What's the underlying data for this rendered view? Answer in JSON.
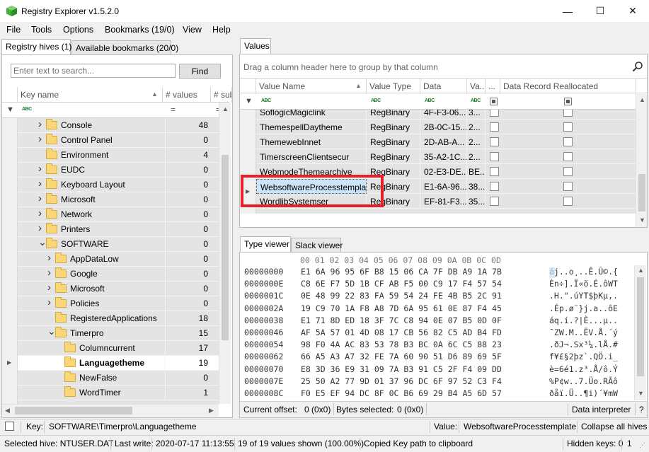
{
  "window": {
    "title": "Registry Explorer v1.5.2.0",
    "minimize": "—",
    "maximize": "☐",
    "close": "✕"
  },
  "menu": [
    "File",
    "Tools",
    "Options",
    "Bookmarks (19/0)",
    "View",
    "Help"
  ],
  "left_tabs": [
    "Registry hives (1)",
    "Available bookmarks (20/0)"
  ],
  "search": {
    "placeholder": "Enter text to search...",
    "button": "Find"
  },
  "tree_headers": {
    "key_name": "Key name",
    "values": "# values",
    "subkeys": "# sub"
  },
  "tree_rows": [
    {
      "name": "Console",
      "values": "48",
      "level": 0,
      "chevron": "right"
    },
    {
      "name": "Control Panel",
      "values": "0",
      "level": 0,
      "chevron": "right"
    },
    {
      "name": "Environment",
      "values": "4",
      "level": 0,
      "chevron": "none"
    },
    {
      "name": "EUDC",
      "values": "0",
      "level": 0,
      "chevron": "right"
    },
    {
      "name": "Keyboard Layout",
      "values": "0",
      "level": 0,
      "chevron": "right"
    },
    {
      "name": "Microsoft",
      "values": "0",
      "level": 0,
      "chevron": "right"
    },
    {
      "name": "Network",
      "values": "0",
      "level": 0,
      "chevron": "right"
    },
    {
      "name": "Printers",
      "values": "0",
      "level": 0,
      "chevron": "right"
    },
    {
      "name": "SOFTWARE",
      "values": "0",
      "level": 0,
      "chevron": "down"
    },
    {
      "name": "AppDataLow",
      "values": "0",
      "level": 1,
      "chevron": "right"
    },
    {
      "name": "Google",
      "values": "0",
      "level": 1,
      "chevron": "right"
    },
    {
      "name": "Microsoft",
      "values": "0",
      "level": 1,
      "chevron": "right"
    },
    {
      "name": "Policies",
      "values": "0",
      "level": 1,
      "chevron": "right"
    },
    {
      "name": "RegisteredApplications",
      "values": "18",
      "level": 1,
      "chevron": "none"
    },
    {
      "name": "Timerpro",
      "values": "15",
      "level": 1,
      "chevron": "down"
    },
    {
      "name": "Columncurrent",
      "values": "17",
      "level": 2,
      "chevron": "none"
    },
    {
      "name": "Languagetheme",
      "values": "19",
      "level": 2,
      "chevron": "none",
      "selected": true
    },
    {
      "name": "NewFalse",
      "values": "0",
      "level": 2,
      "chevron": "none"
    },
    {
      "name": "WordTimer",
      "values": "1",
      "level": 2,
      "chevron": "none"
    }
  ],
  "values_tab": "Values",
  "group_hint": "Drag a column header here to group by that column",
  "value_headers": {
    "name": "Value Name",
    "type": "Value Type",
    "data": "Data",
    "va": "Va...",
    "dots": "...",
    "reallocated": "Data Record Reallocated"
  },
  "value_rows": [
    {
      "name": "SoflogicMagiclink",
      "type": "RegBinary",
      "data": "4F-F3-06...",
      "va": "3..."
    },
    {
      "name": "ThemespellDaytheme",
      "type": "RegBinary",
      "data": "2B-0C-15...",
      "va": "2..."
    },
    {
      "name": "ThemewebInnet",
      "type": "RegBinary",
      "data": "2D-AB-A...",
      "va": "2..."
    },
    {
      "name": "TimerscreenClientsecur",
      "type": "RegBinary",
      "data": "35-A2-1C...",
      "va": "2..."
    },
    {
      "name": "WebmodeThemearchive",
      "type": "RegBinary",
      "data": "02-E3-DE...",
      "va": "BE..."
    },
    {
      "name": "WebsoftwareProcesstemplate",
      "type": "RegBinary",
      "data": "E1-6A-96...",
      "va": "38...",
      "selected": true
    },
    {
      "name": "WordlibSystemser",
      "type": "RegBinary",
      "data": "EF-81-F3...",
      "va": "35..."
    }
  ],
  "bottom_tabs": [
    "Type viewer",
    "Slack viewer"
  ],
  "hex_header": "00 01 02 03 04 05 06 07 08 09 0A 0B 0C 0D",
  "hex_rows": [
    {
      "off": "00000000",
      "bytes": "E1 6A 96 95 6F B8 15 06 CA 7F DB A9 1A 7B",
      "ascii": "áj..o¸..Ê.Û©.{"
    },
    {
      "off": "0000000E",
      "bytes": "C8 6E F7 5D 1B CF AB F5 00 C9 17 F4 57 54",
      "ascii": "Èn÷].Ï«õ.É.ôWT"
    },
    {
      "off": "0000001C",
      "bytes": "0E 48 99 22 83 FA 59 54 24 FE 4B B5 2C 91",
      "ascii": ".H.\".úYT$þKµ,."
    },
    {
      "off": "0000002A",
      "bytes": "19 C9 70 1A F8 A8 7D 6A 95 61 0E 87 F4 45",
      "ascii": ".Ép.ø¨}j.a..ôE"
    },
    {
      "off": "00000038",
      "bytes": "E1 71 8D ED 18 3F 7C C8 94 0E 07 B5 0D 0F",
      "ascii": "áq.í.?|È...µ.."
    },
    {
      "off": "00000046",
      "bytes": "AF 5A 57 01 4D 08 17 CB 56 82 C5 AD B4 FD",
      "ascii": "¯ZW.M..ËV.Å.´ý"
    },
    {
      "off": "00000054",
      "bytes": "98 F0 4A AC 83 53 78 B3 BC 0A 6C C5 88 23",
      "ascii": ".ðJ¬.Sx³¼.lÅ.#"
    },
    {
      "off": "00000062",
      "bytes": "66 A5 A3 A7 32 FE 7A 60 90 51 D6 89 69 5F",
      "ascii": "f¥£§2þz`.QÖ.i_"
    },
    {
      "off": "00000070",
      "bytes": "E8 3D 36 E9 31 09 7A B3 91 C5 2F F4 09 DD",
      "ascii": "è=6é1.z³.Å/ô.Ý"
    },
    {
      "off": "0000007E",
      "bytes": "25 50 A2 77 9D 01 37 96 DC 6F 97 52 C3 F4",
      "ascii": "%P¢w..7.Üo.RÃô"
    },
    {
      "off": "0000008C",
      "bytes": "F0 E5 EF 94 DC 8F 0C B6 69 29 B4 A5 6D 57",
      "ascii": "ðåï.Ü..¶i)´¥mW"
    },
    {
      "off": "0000009A",
      "bytes": "61 6D 6D D0 49 40 99 80 E8 C4 44 6E 00 00",
      "ascii": "ammÐI@..èÄDn.."
    }
  ],
  "offset_bar": {
    "current_offset_label": "Current offset:",
    "current_offset": "0 (0x0)",
    "bytes_selected_label": "Bytes selected:",
    "bytes_selected": "0 (0x0)",
    "interpreter": "Data interpreter",
    "help": "?"
  },
  "status1": {
    "key_label": "Key:",
    "key": "SOFTWARE\\Timerpro\\Languagetheme",
    "value_label": "Value:",
    "value": "WebsoftwareProcesstemplate",
    "collapse": "Collapse all hives"
  },
  "status2": {
    "hive": "Selected hive: NTUSER.DAT",
    "last_write_label": "Last write:",
    "last_write": "2020-07-17 11:13:55",
    "shown": "19 of 19 values shown (100.00%)",
    "copied": "Copied Key path to clipboard",
    "hidden_keys": "Hidden keys: 0",
    "count": "1"
  },
  "colors": {
    "accent_red": "#e8202a",
    "selection": "#cce4f7",
    "folder": "#f9d776"
  }
}
